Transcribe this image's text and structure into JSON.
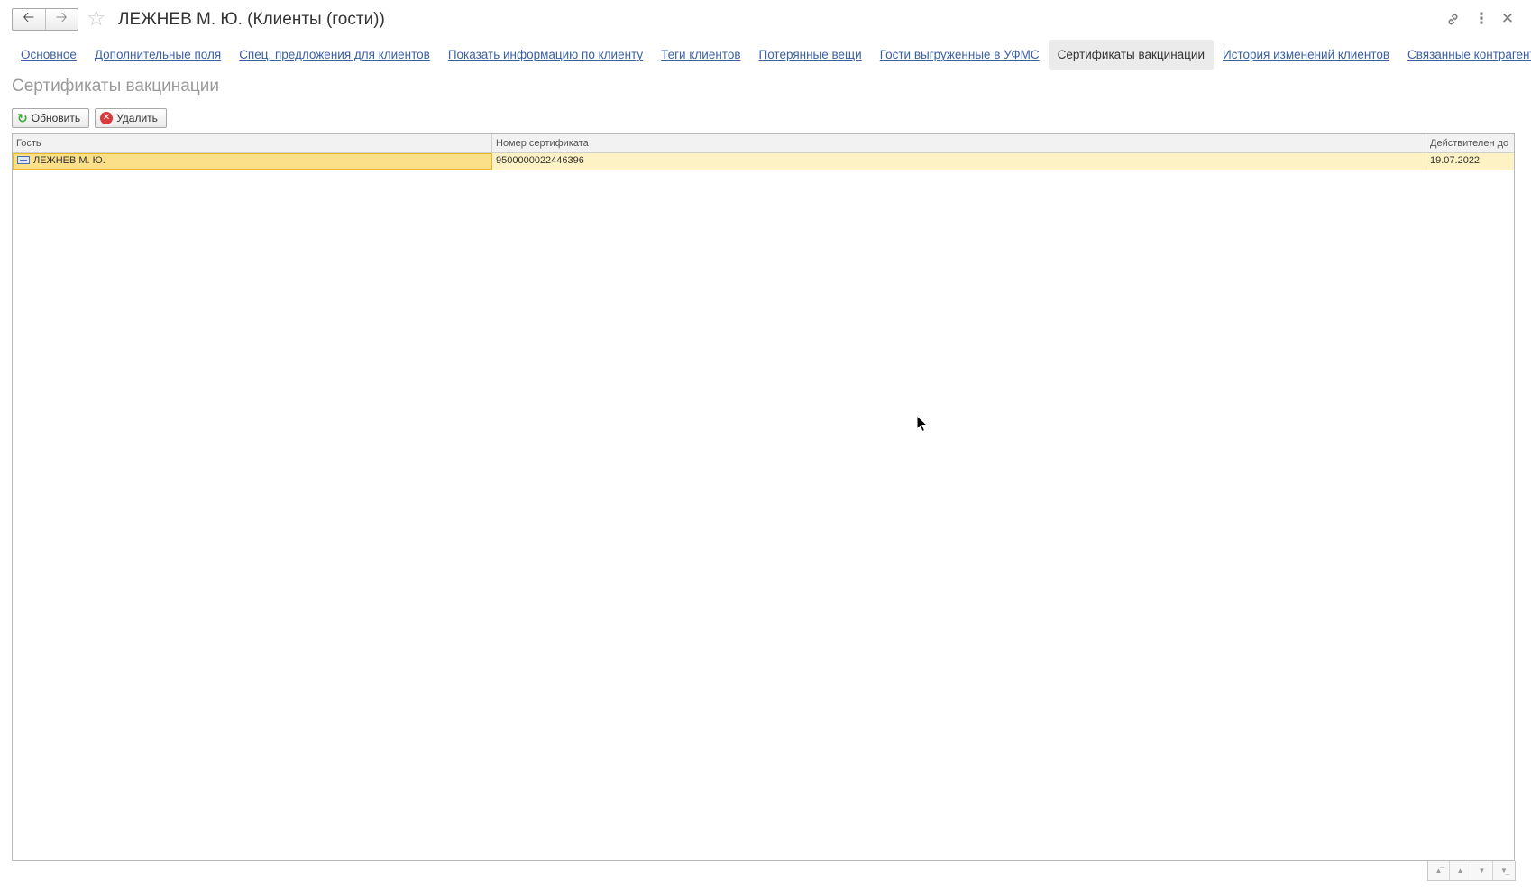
{
  "window": {
    "title": "ЛЕЖНЕВ М. Ю. (Клиенты (гости))"
  },
  "titlebar": {
    "back_icon": "arrow-left-icon",
    "forward_icon": "arrow-right-icon",
    "favorite_icon": "star-icon",
    "link_icon": "link-icon",
    "more_icon": "more-vertical-icon",
    "close_icon": "close-icon"
  },
  "tabs": [
    {
      "label": "Основное",
      "active": false
    },
    {
      "label": "Дополнительные поля",
      "active": false
    },
    {
      "label": "Спец. предложения для клиентов",
      "active": false
    },
    {
      "label": "Показать информацию по клиенту",
      "active": false
    },
    {
      "label": "Теги клиентов",
      "active": false
    },
    {
      "label": "Потерянные вещи",
      "active": false
    },
    {
      "label": "Гости выгруженные в УФМС",
      "active": false
    },
    {
      "label": "Сертификаты вакцинации",
      "active": true
    },
    {
      "label": "История изменений клиентов",
      "active": false
    },
    {
      "label": "Связанные контрагенты",
      "active": false
    }
  ],
  "section": {
    "title": "Сертификаты вакцинации"
  },
  "toolbar": {
    "refresh_label": "Обновить",
    "delete_label": "Удалить"
  },
  "table": {
    "columns": [
      "Гость",
      "Номер сертификата",
      "Действителен до"
    ],
    "rows": [
      {
        "guest": "ЛЕЖНЕВ М. Ю.",
        "certificate": "9500000022446396",
        "valid_until": "19.07.2022"
      }
    ]
  },
  "colors": {
    "link": "#3b5fa5",
    "selected_row": "#fdf2c4",
    "focused_cell": "#fbe089",
    "refresh_icon": "#3aa83a",
    "delete_icon": "#d93a3a"
  }
}
